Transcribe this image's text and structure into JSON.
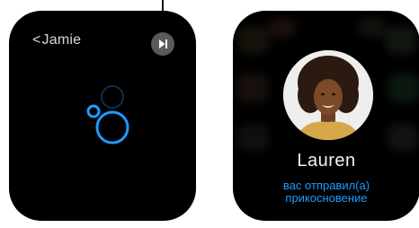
{
  "left_watch": {
    "back_chevron": "<",
    "back_label": "Jamie",
    "send_icon": "play-pause-icon",
    "accent_color": "#1e9bff"
  },
  "right_watch": {
    "contact_name": "Lauren",
    "status_line_1": "вас отправил(а)",
    "status_line_2": "прикосновение",
    "status_color": "#1e9bff"
  }
}
